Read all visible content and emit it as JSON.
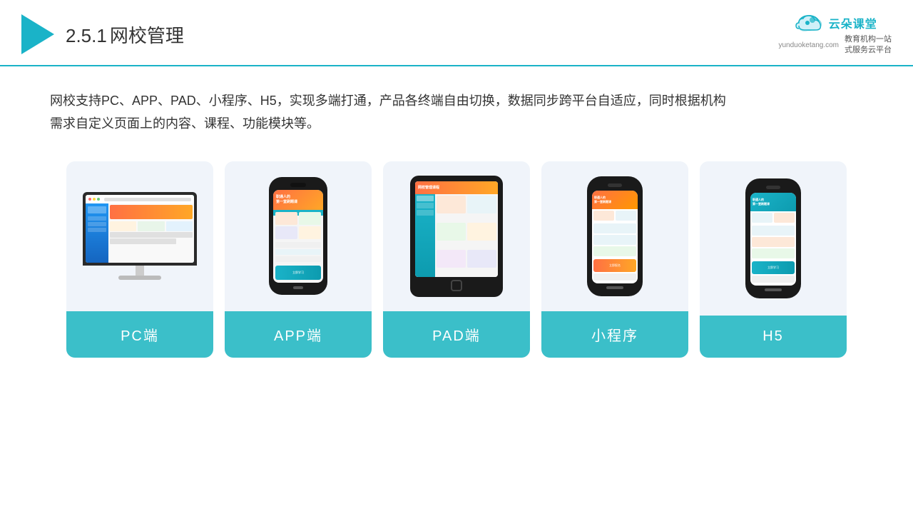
{
  "header": {
    "section_number": "2.5.1",
    "section_title": "网校管理",
    "brand_name": "云朵课堂",
    "brand_url": "yunduoketang.com",
    "brand_slogan": "教育机构一站\n式服务云平台"
  },
  "description": {
    "text": "网校支持PC、APP、PAD、小程序、H5，实现多端打通，产品各终端自由切换，数据同步跨平台自适应，同时根据机构需求自定义页面上的内容、课程、功能模块等。"
  },
  "cards": [
    {
      "id": "pc",
      "label": "PC端"
    },
    {
      "id": "app",
      "label": "APP端"
    },
    {
      "id": "pad",
      "label": "PAD端"
    },
    {
      "id": "miniprogram",
      "label": "小程序"
    },
    {
      "id": "h5",
      "label": "H5"
    }
  ]
}
